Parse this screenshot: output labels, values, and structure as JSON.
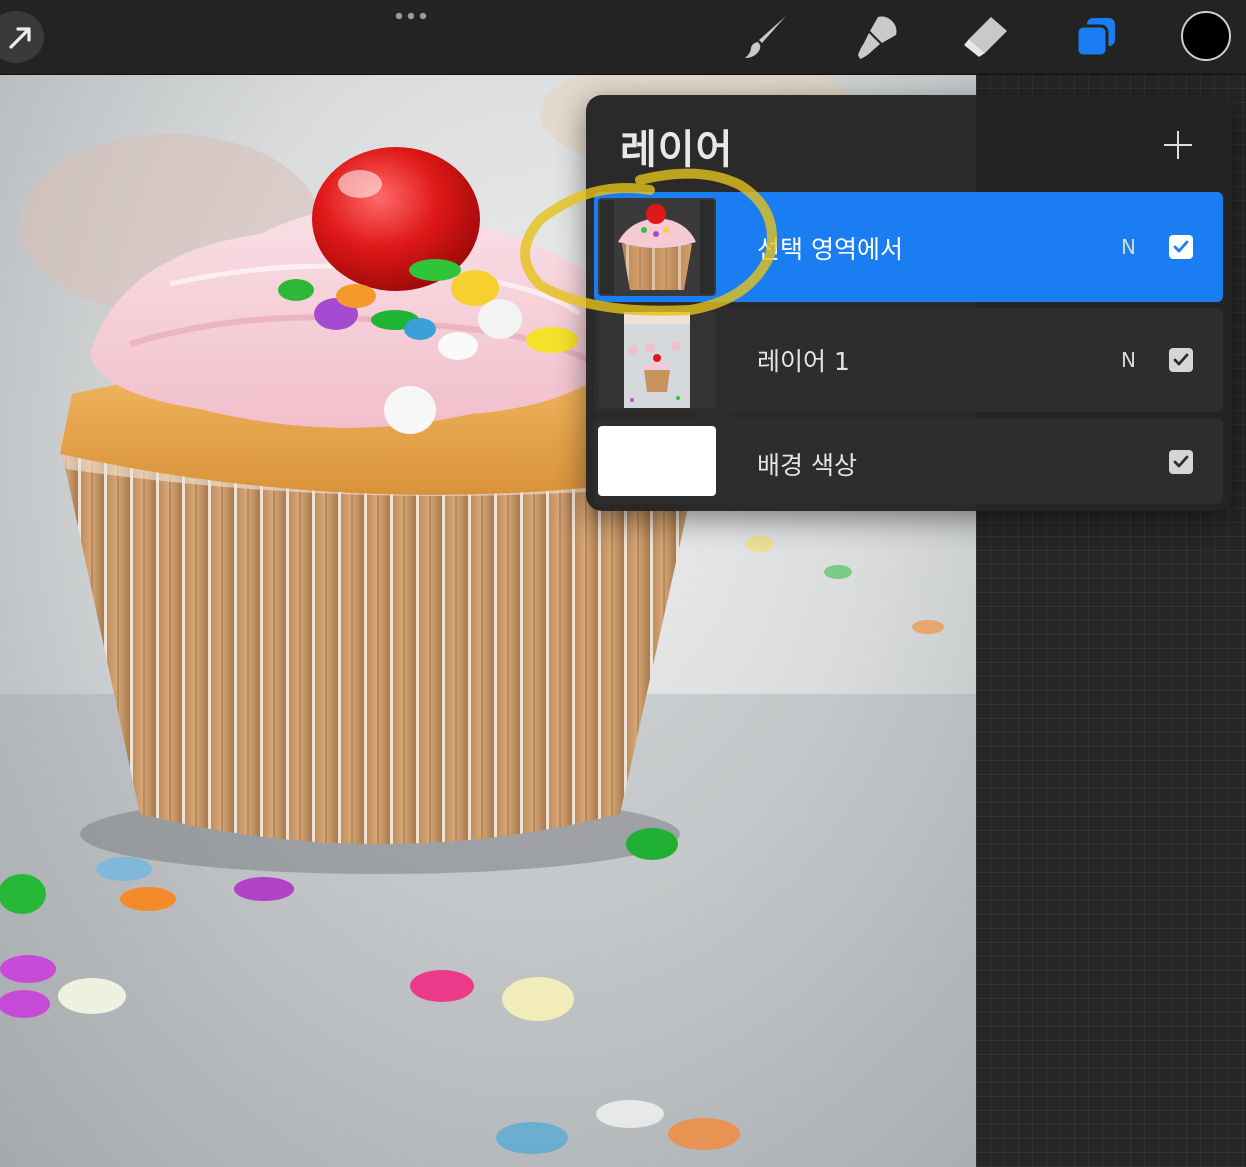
{
  "toolbar": {
    "tools": [
      {
        "name": "brush-icon",
        "active": false
      },
      {
        "name": "smudge-icon",
        "active": false
      },
      {
        "name": "eraser-icon",
        "active": false
      },
      {
        "name": "layers-icon",
        "active": true
      }
    ],
    "active_color": "#000000",
    "accent": "#1a7ef2"
  },
  "layers_panel": {
    "title": "레이어",
    "layers": [
      {
        "name": "선택 영역에서",
        "blend": "N",
        "visible": true,
        "selected": true
      },
      {
        "name": "레이어 1",
        "blend": "N",
        "visible": true,
        "selected": false
      },
      {
        "name": "배경 색상",
        "blend": "",
        "visible": true,
        "selected": false
      }
    ]
  }
}
